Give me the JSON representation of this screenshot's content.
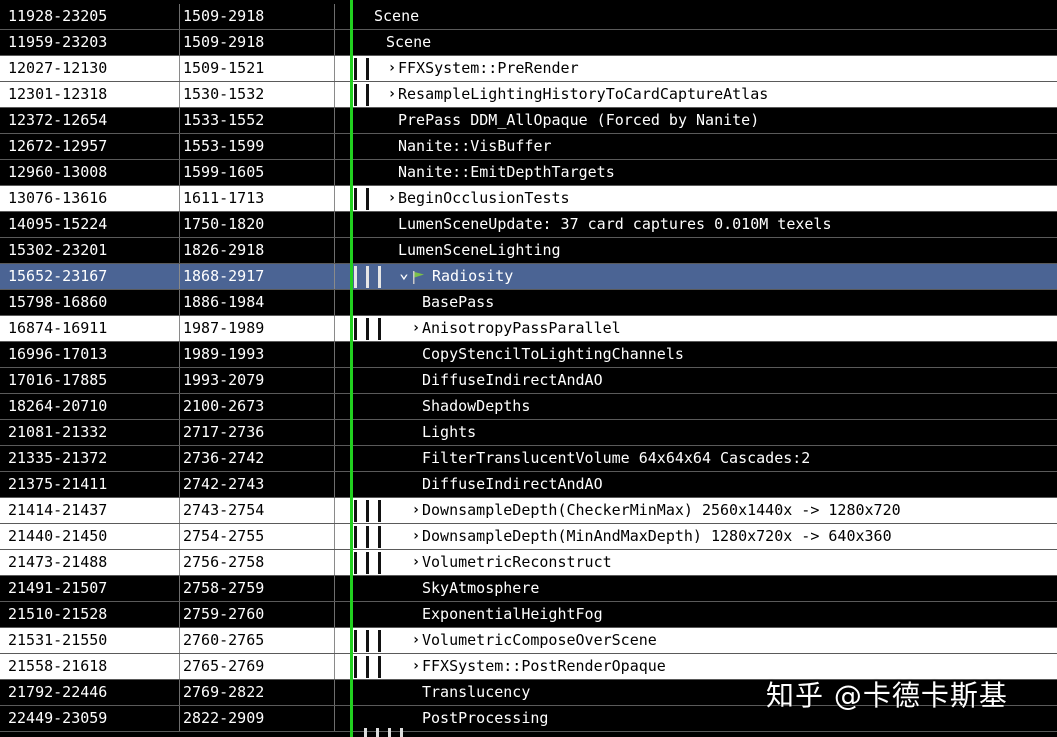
{
  "rows": [
    {
      "eid": "11928-23205",
      "duration": "1509-2918",
      "name": "Scene",
      "depth": 0,
      "style": "dark",
      "expander": false,
      "bars": 0
    },
    {
      "eid": "11959-23203",
      "duration": "1509-2918",
      "name": "Scene",
      "depth": 1,
      "style": "dark",
      "expander": false,
      "bars": 0
    },
    {
      "eid": "12027-12130",
      "duration": "1509-1521",
      "name": "FFXSystem::PreRender",
      "depth": 2,
      "style": "light",
      "expander": true,
      "bars": 2
    },
    {
      "eid": "12301-12318",
      "duration": "1530-1532",
      "name": "ResampleLightingHistoryToCardCaptureAtlas",
      "depth": 2,
      "style": "light",
      "expander": true,
      "bars": 2
    },
    {
      "eid": "12372-12654",
      "duration": "1533-1552",
      "name": "PrePass DDM_AllOpaque (Forced by Nanite)",
      "depth": 2,
      "style": "dark",
      "expander": false,
      "bars": 0
    },
    {
      "eid": "12672-12957",
      "duration": "1553-1599",
      "name": "Nanite::VisBuffer",
      "depth": 2,
      "style": "dark",
      "expander": false,
      "bars": 0
    },
    {
      "eid": "12960-13008",
      "duration": "1599-1605",
      "name": "Nanite::EmitDepthTargets",
      "depth": 2,
      "style": "dark",
      "expander": false,
      "bars": 0
    },
    {
      "eid": "13076-13616",
      "duration": "1611-1713",
      "name": "BeginOcclusionTests",
      "depth": 2,
      "style": "light",
      "expander": true,
      "bars": 2
    },
    {
      "eid": "14095-15224",
      "duration": "1750-1820",
      "name": "LumenSceneUpdate: 37 card captures 0.010M texels",
      "depth": 2,
      "style": "dark",
      "expander": false,
      "bars": 0
    },
    {
      "eid": "15302-23201",
      "duration": "1826-2918",
      "name": "LumenSceneLighting",
      "depth": 2,
      "style": "dark",
      "expander": false,
      "bars": 0
    },
    {
      "eid": "15652-23167",
      "duration": "1868-2917",
      "name": "Radiosity",
      "depth": 3,
      "style": "sel",
      "expander": "open",
      "flag": true,
      "bars": 3
    },
    {
      "eid": "15798-16860",
      "duration": "1886-1984",
      "name": "BasePass",
      "depth": 4,
      "style": "dark",
      "expander": false,
      "bars": 0
    },
    {
      "eid": "16874-16911",
      "duration": "1987-1989",
      "name": "AnisotropyPassParallel",
      "depth": 4,
      "style": "light",
      "expander": true,
      "bars": 3
    },
    {
      "eid": "16996-17013",
      "duration": "1989-1993",
      "name": "CopyStencilToLightingChannels",
      "depth": 4,
      "style": "dark",
      "expander": false,
      "bars": 0
    },
    {
      "eid": "17016-17885",
      "duration": "1993-2079",
      "name": "DiffuseIndirectAndAO",
      "depth": 4,
      "style": "dark",
      "expander": false,
      "bars": 0
    },
    {
      "eid": "18264-20710",
      "duration": "2100-2673",
      "name": "ShadowDepths",
      "depth": 4,
      "style": "dark",
      "expander": false,
      "bars": 0
    },
    {
      "eid": "21081-21332",
      "duration": "2717-2736",
      "name": "Lights",
      "depth": 4,
      "style": "dark",
      "expander": false,
      "bars": 0
    },
    {
      "eid": "21335-21372",
      "duration": "2736-2742",
      "name": "FilterTranslucentVolume 64x64x64 Cascades:2",
      "depth": 4,
      "style": "dark",
      "expander": false,
      "bars": 0
    },
    {
      "eid": "21375-21411",
      "duration": "2742-2743",
      "name": "DiffuseIndirectAndAO",
      "depth": 4,
      "style": "dark",
      "expander": false,
      "bars": 0
    },
    {
      "eid": "21414-21437",
      "duration": "2743-2754",
      "name": "DownsampleDepth(CheckerMinMax) 2560x1440x -> 1280x720",
      "depth": 4,
      "style": "light",
      "expander": true,
      "bars": 3
    },
    {
      "eid": "21440-21450",
      "duration": "2754-2755",
      "name": "DownsampleDepth(MinAndMaxDepth) 1280x720x -> 640x360",
      "depth": 4,
      "style": "light",
      "expander": true,
      "bars": 3
    },
    {
      "eid": "21473-21488",
      "duration": "2756-2758",
      "name": "VolumetricReconstruct",
      "depth": 4,
      "style": "light",
      "expander": true,
      "bars": 3
    },
    {
      "eid": "21491-21507",
      "duration": "2758-2759",
      "name": "SkyAtmosphere",
      "depth": 4,
      "style": "dark",
      "expander": false,
      "bars": 0
    },
    {
      "eid": "21510-21528",
      "duration": "2759-2760",
      "name": "ExponentialHeightFog",
      "depth": 4,
      "style": "dark",
      "expander": false,
      "bars": 0
    },
    {
      "eid": "21531-21550",
      "duration": "2760-2765",
      "name": "VolumetricComposeOverScene",
      "depth": 4,
      "style": "light",
      "expander": true,
      "bars": 3
    },
    {
      "eid": "21558-21618",
      "duration": "2765-2769",
      "name": "FFXSystem::PostRenderOpaque",
      "depth": 4,
      "style": "light",
      "expander": true,
      "bars": 3
    },
    {
      "eid": "21792-22446",
      "duration": "2769-2822",
      "name": "Translucency",
      "depth": 4,
      "style": "dark",
      "expander": false,
      "bars": 0
    },
    {
      "eid": "22449-23059",
      "duration": "2822-2909",
      "name": "PostProcessing",
      "depth": 4,
      "style": "dark",
      "expander": false,
      "bars": 0
    }
  ],
  "watermark": "知乎 @卡德卡斯基",
  "colors": {
    "selection": "#4b6494",
    "marker_line": "#21d11f",
    "flag": "#7cc14a"
  }
}
